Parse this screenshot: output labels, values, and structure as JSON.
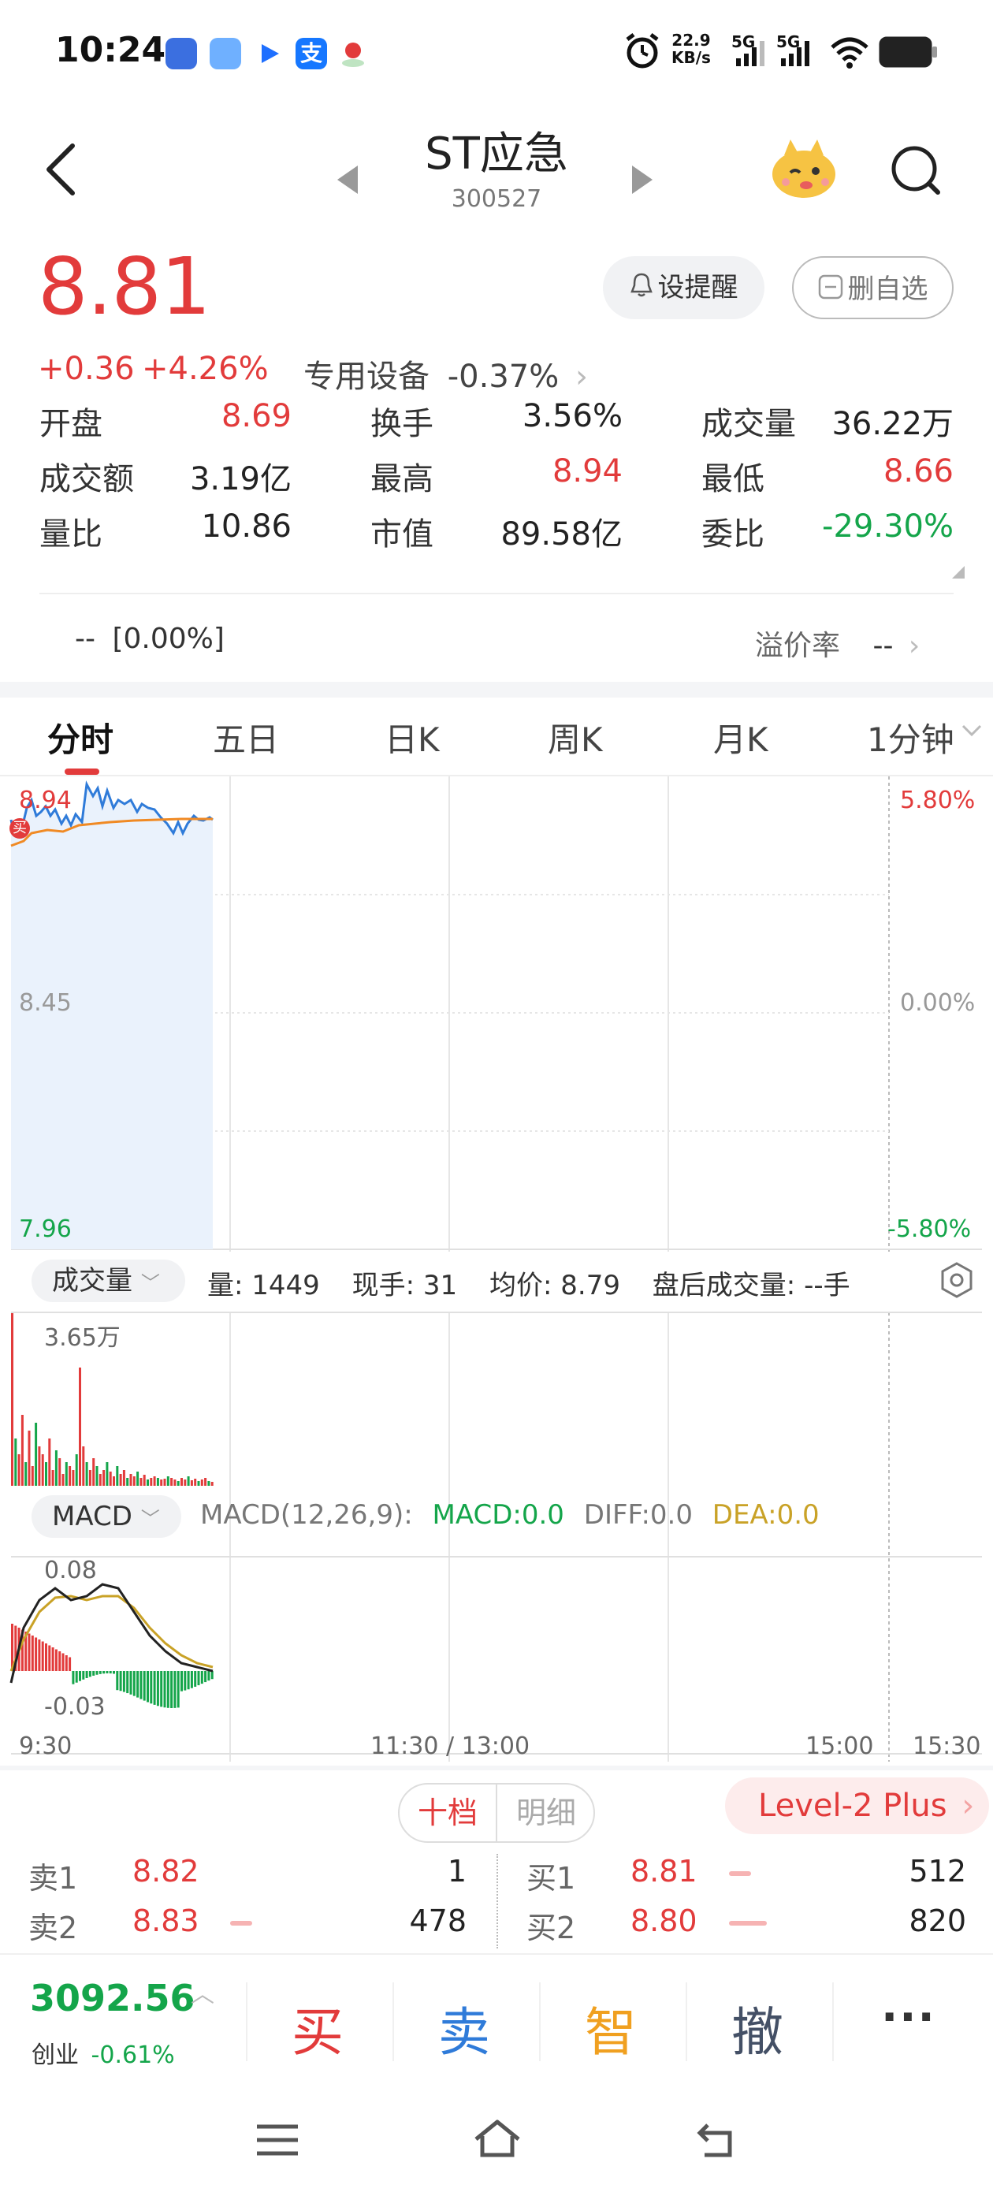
{
  "status_bar": {
    "time": "10:24",
    "net_speed_value": "22.9",
    "net_speed_unit": "KB/s",
    "sim1": "5G",
    "sim2": "5G",
    "icons": [
      "alarm-icon",
      "signal-icon",
      "wifi-icon",
      "battery-icon"
    ]
  },
  "header": {
    "title": "ST应急",
    "code": "300527"
  },
  "quote": {
    "price": "8.81",
    "change": "+0.36",
    "change_pct": "+4.26%",
    "sector_name": "专用设备",
    "sector_change": "-0.37%",
    "alert_label": "设提醒",
    "delete_label": "删自选"
  },
  "stats": [
    {
      "label": "开盘",
      "value": "8.69",
      "color": "#e23b3b"
    },
    {
      "label": "换手",
      "value": "3.56%",
      "color": "#222222"
    },
    {
      "label": "成交量",
      "value": "36.22万",
      "color": "#222222"
    },
    {
      "label": "成交额",
      "value": "3.19亿",
      "color": "#222222"
    },
    {
      "label": "最高",
      "value": "8.94",
      "color": "#e23b3b"
    },
    {
      "label": "最低",
      "value": "8.66",
      "color": "#e23b3b"
    },
    {
      "label": "量比",
      "value": "10.86",
      "color": "#222222"
    },
    {
      "label": "市值",
      "value": "89.58亿",
      "color": "#222222"
    },
    {
      "label": "委比",
      "value": "-29.30%",
      "color": "#14a54a"
    }
  ],
  "premium": {
    "left_value": "--",
    "left_pct": "[0.00%]",
    "label": "溢价率",
    "value": "--"
  },
  "tabs": [
    {
      "label": "分时",
      "active": true
    },
    {
      "label": "五日",
      "active": false
    },
    {
      "label": "日K",
      "active": false
    },
    {
      "label": "周K",
      "active": false
    },
    {
      "label": "月K",
      "active": false
    },
    {
      "label": "1分钟",
      "active": false
    }
  ],
  "intraday": {
    "price_high": "8.94",
    "price_mid": "8.45",
    "price_low": "7.96",
    "pct_high": "5.80%",
    "pct_mid": "0.00%",
    "pct_low": "-5.80%",
    "buy_marker": "买",
    "colors": {
      "price_line": "#2f7bd9",
      "avg_line": "#f08a24",
      "up": "#e23b3b",
      "down": "#14a54a"
    }
  },
  "volume_panel": {
    "selector": "成交量",
    "volume_label": "量:",
    "volume_value": "1449",
    "hand_label": "现手:",
    "hand_value": "31",
    "avg_label": "均价:",
    "avg_value": "8.79",
    "after_label": "盘后成交量:",
    "after_value": "--手",
    "max_label": "3.65万"
  },
  "macd_panel": {
    "selector": "MACD",
    "params": "MACD(12,26,9):",
    "macd": "MACD:0.0",
    "diff": "DIFF:0.0",
    "dea": "DEA:0.0",
    "top_label": "0.08",
    "bottom_label": "-0.03"
  },
  "time_axis": {
    "t0": "9:30",
    "t1": "11:30 / 13:00",
    "t2": "15:00",
    "t3": "15:30"
  },
  "order_book": {
    "tab_ten": "十档",
    "tab_detail": "明细",
    "level2": "Level-2 Plus",
    "sell": [
      {
        "label": "卖1",
        "price": "8.82",
        "qty": "1"
      },
      {
        "label": "卖2",
        "price": "8.83",
        "qty": "478"
      }
    ],
    "buy": [
      {
        "label": "买1",
        "price": "8.81",
        "qty": "512"
      },
      {
        "label": "买2",
        "price": "8.80",
        "qty": "820"
      }
    ]
  },
  "bottom": {
    "index_value": "3092.56",
    "index_name": "创业",
    "index_change": "-0.61%",
    "buy": "买",
    "sell": "卖",
    "smart": "智",
    "cancel": "撤",
    "more": "···"
  }
}
